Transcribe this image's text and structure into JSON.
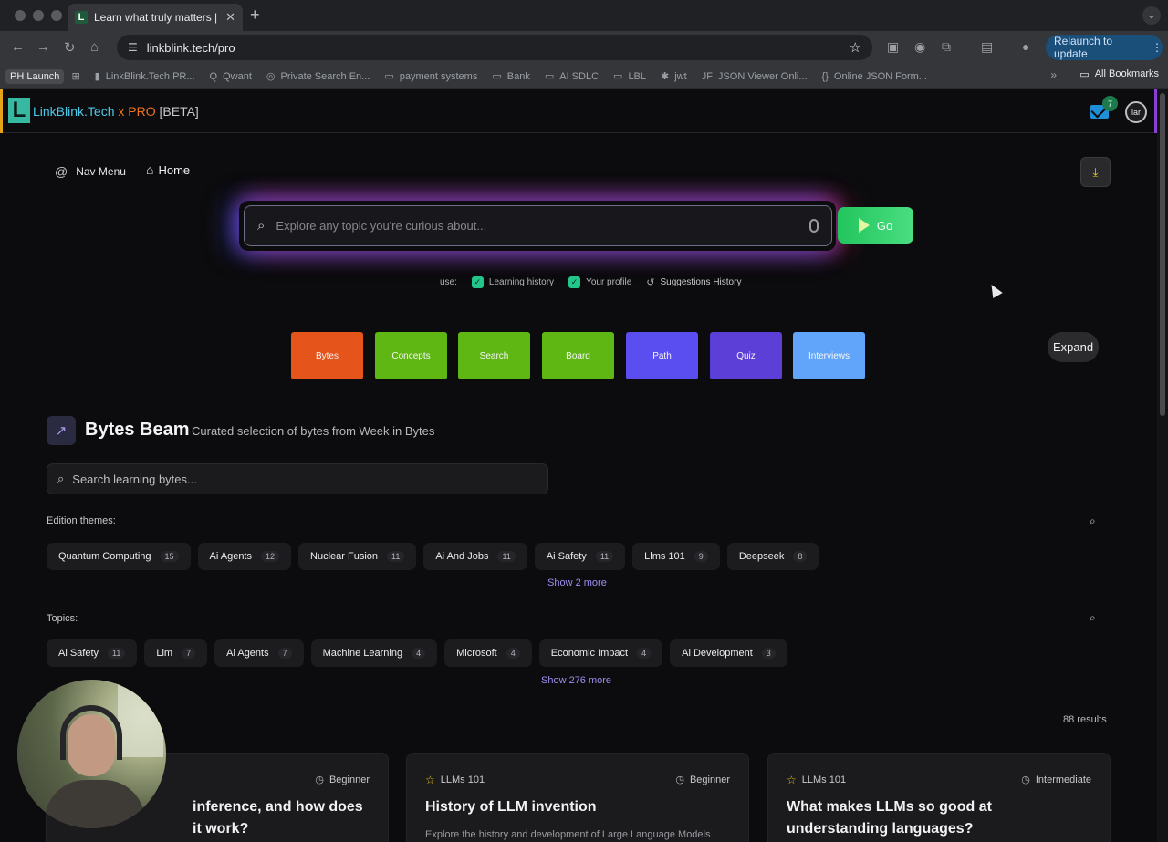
{
  "browser": {
    "tab_title": "Learn what truly matters | LinkBlink",
    "tab_favicon": "L",
    "url": "linkblink.tech/pro",
    "relaunch_label": "Relaunch to update",
    "bookmarks": [
      {
        "label": "PH Launch",
        "icon": "none"
      },
      {
        "label": "",
        "icon": "apps-grid-icon"
      },
      {
        "label": "LinkBlink.Tech PR...",
        "icon": "linkblink-icon"
      },
      {
        "label": "Qwant",
        "icon": "qwant-icon"
      },
      {
        "label": "Private Search En...",
        "icon": "search-engine-icon"
      },
      {
        "label": "payment systems",
        "icon": "folder-icon"
      },
      {
        "label": "Bank",
        "icon": "folder-icon"
      },
      {
        "label": "AI SDLC",
        "icon": "folder-icon"
      },
      {
        "label": "LBL",
        "icon": "folder-icon"
      },
      {
        "label": "jwt",
        "icon": "jwt-icon"
      },
      {
        "label": "JSON Viewer Onli...",
        "icon": "json-icon"
      },
      {
        "label": "Online JSON Form...",
        "icon": "json-icon"
      }
    ],
    "all_bookmarks": "All Bookmarks"
  },
  "app": {
    "brand_name": "LinkBlink.Tech",
    "brand_x": " x ",
    "brand_pro": "PRO",
    "brand_beta": "[BETA]",
    "mail_count": "7",
    "user_initials": "lar",
    "nav_menu": "Nav Menu",
    "home": "Home"
  },
  "search": {
    "placeholder": "Explore any topic you're curious about...",
    "go_label": "Go",
    "use_label": "use:",
    "learning_history": "Learning history",
    "your_profile": "Your profile",
    "suggestions_history": "Suggestions History"
  },
  "modes": [
    {
      "label": "Bytes",
      "color": "#e4541b"
    },
    {
      "label": "Concepts",
      "color": "#5fb713"
    },
    {
      "label": "Search",
      "color": "#5fb713"
    },
    {
      "label": "Board",
      "color": "#5fb713"
    },
    {
      "label": "Path",
      "color": "#5b4ef0"
    },
    {
      "label": "Quiz",
      "color": "#5b3fd6"
    },
    {
      "label": "Interviews",
      "color": "#60a5fa"
    }
  ],
  "expand_label": "Expand",
  "beam": {
    "title": "Bytes Beam",
    "subtitle": "Curated selection of bytes from Week in Bytes",
    "search_placeholder": "Search learning bytes..."
  },
  "edition_themes": {
    "label": "Edition themes:",
    "chips": [
      {
        "name": "Quantum Computing",
        "count": "15"
      },
      {
        "name": "Ai Agents",
        "count": "12"
      },
      {
        "name": "Nuclear Fusion",
        "count": "11"
      },
      {
        "name": "Ai And Jobs",
        "count": "11"
      },
      {
        "name": "Ai Safety",
        "count": "11"
      },
      {
        "name": "Llms 101",
        "count": "9"
      },
      {
        "name": "Deepseek",
        "count": "8"
      }
    ],
    "show_more": "Show 2 more"
  },
  "topics": {
    "label": "Topics:",
    "chips": [
      {
        "name": "Ai Safety",
        "count": "11"
      },
      {
        "name": "Llm",
        "count": "7"
      },
      {
        "name": "Ai Agents",
        "count": "7"
      },
      {
        "name": "Machine Learning",
        "count": "4"
      },
      {
        "name": "Microsoft",
        "count": "4"
      },
      {
        "name": "Economic Impact",
        "count": "4"
      },
      {
        "name": "Ai Development",
        "count": "3"
      }
    ],
    "show_more": "Show 276 more"
  },
  "results_count": "88 results",
  "cards": [
    {
      "tag": "",
      "level": "Beginner",
      "title": "inference, and how does it work?",
      "desc": ""
    },
    {
      "tag": "LLMs 101",
      "level": "Beginner",
      "title": "History of LLM invention",
      "desc": "Explore the history and development of Large Language Models"
    },
    {
      "tag": "LLMs 101",
      "level": "Intermediate",
      "title": "What makes LLMs so good at understanding languages?",
      "desc": ""
    }
  ]
}
